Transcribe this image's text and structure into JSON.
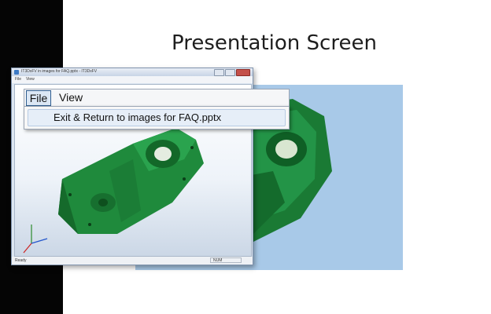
{
  "slide": {
    "title": "Presentation Screen"
  },
  "window": {
    "title": "IT3DxFV in images for FAQ.pptx - IT3DxFV",
    "menu_file": "File",
    "menu_view": "View",
    "status_left": "Ready",
    "status_right": "NUM"
  },
  "zoom_menu": {
    "file_label": "File",
    "view_label": "View",
    "dropdown_item": "Exit & Return to images for FAQ.pptx"
  },
  "icons": [
    "window-app-icon",
    "minimize-icon",
    "maximize-icon",
    "close-icon",
    "axis-triad-icon"
  ],
  "colors": {
    "model_green": "#1f8a3c",
    "slide_picture_bg": "#a8c9e8",
    "highlight": "#dbe7f5"
  }
}
